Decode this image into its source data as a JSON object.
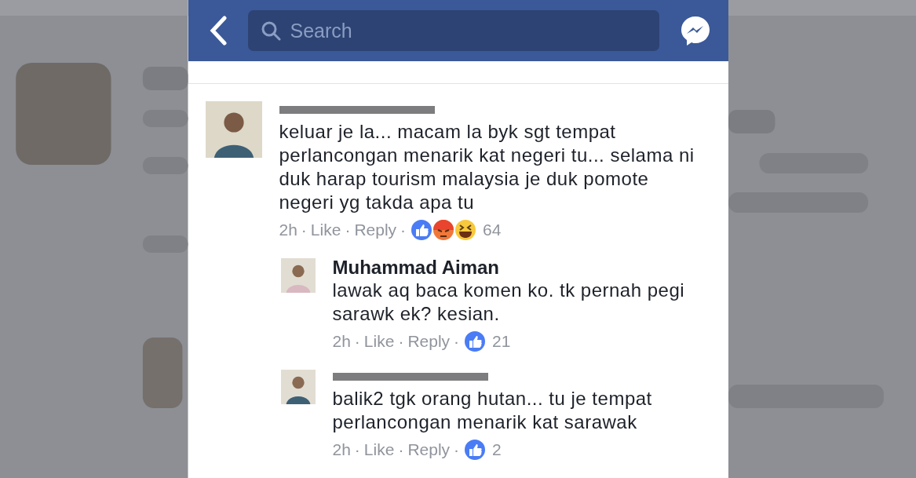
{
  "search": {
    "placeholder": "Search"
  },
  "comments": [
    {
      "redacted": true,
      "text": "keluar je la... macam la byk sgt tempat perlancongan menarik kat negeri tu... selama ni duk harap tourism malaysia je duk pomote negeri yg takda apa tu",
      "time": "2h",
      "sep": "·",
      "like": "Like",
      "reply": "Reply",
      "reactions": [
        {
          "kind": "like"
        },
        {
          "kind": "angry"
        },
        {
          "kind": "haha"
        }
      ],
      "count": "64",
      "children": [
        {
          "redacted": false,
          "name": "Muhammad Aiman",
          "text": "lawak aq baca komen ko. tk pernah pegi sarawk ek? kesian.",
          "time": "2h",
          "sep": "·",
          "like": "Like",
          "reply": "Reply",
          "reactions": [
            {
              "kind": "like"
            }
          ],
          "count": "21"
        },
        {
          "redacted": true,
          "text": "balik2 tgk orang hutan... tu je tempat perlancongan menarik kat sarawak",
          "time": "2h",
          "sep": "·",
          "like": "Like",
          "reply": "Reply",
          "reactions": [
            {
              "kind": "like"
            }
          ],
          "count": "2"
        }
      ]
    }
  ]
}
